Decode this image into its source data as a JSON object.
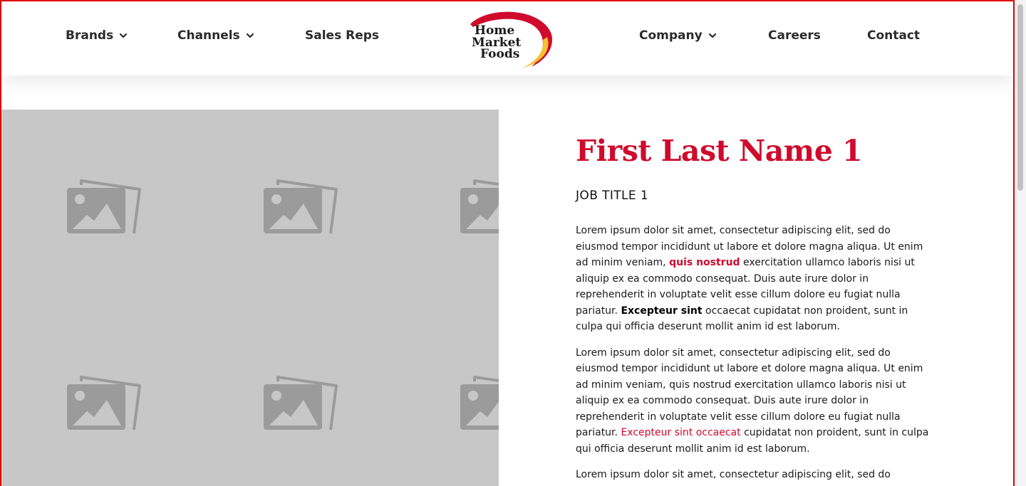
{
  "nav": {
    "brands": "Brands",
    "channels": "Channels",
    "sales_reps": "Sales Reps",
    "company": "Company",
    "careers": "Careers",
    "contact": "Contact"
  },
  "logo": {
    "line1": "Home",
    "line2": "Market",
    "line3": "Foods"
  },
  "profile": {
    "name": "First Last Name 1",
    "job_title": "JOB TITLE 1",
    "p1_a": "Lorem ipsum dolor sit amet, consectetur adipiscing elit, sed do eiusmod tempor incididunt ut labore et dolore magna aliqua. Ut enim ad minim veniam, ",
    "p1_link": "quis nostrud",
    "p1_b": " exercitation ullamco laboris nisi ut aliquip ex ea commodo consequat. Duis aute irure dolor in reprehenderit in voluptate velit esse cillum dolore eu fugiat nulla pariatur. ",
    "p1_bold": "Excepteur sint",
    "p1_c": " occaecat cupidatat non proident, sunt in culpa qui officia deserunt mollit anim id est laborum.",
    "p2_a": "Lorem ipsum dolor sit amet, consectetur adipiscing elit, sed do eiusmod tempor incididunt ut labore et dolore magna aliqua. Ut enim ad minim veniam, quis nostrud exercitation ullamco laboris nisi ut aliquip ex ea commodo consequat. Duis aute irure dolor in reprehenderit in voluptate velit esse cillum dolore eu fugiat nulla pariatur. ",
    "p2_link": "Excepteur sint occaecat",
    "p2_b": " cupidatat non proident, sunt in culpa qui officia deserunt mollit anim id est laborum.",
    "p3": "Lorem ipsum dolor sit amet, consectetur adipiscing elit, sed do eiusmod tempor incididunt ut labore et dolore magna aliqua."
  },
  "colors": {
    "brand_red": "#cf0a2c",
    "brand_yellow": "#f2c230",
    "placeholder_bg": "#c7c7c7",
    "placeholder_icon": "#9b9b9b"
  },
  "icons": {
    "dropdown": "chevron-down-icon",
    "placeholder": "image-placeholder-icon"
  }
}
